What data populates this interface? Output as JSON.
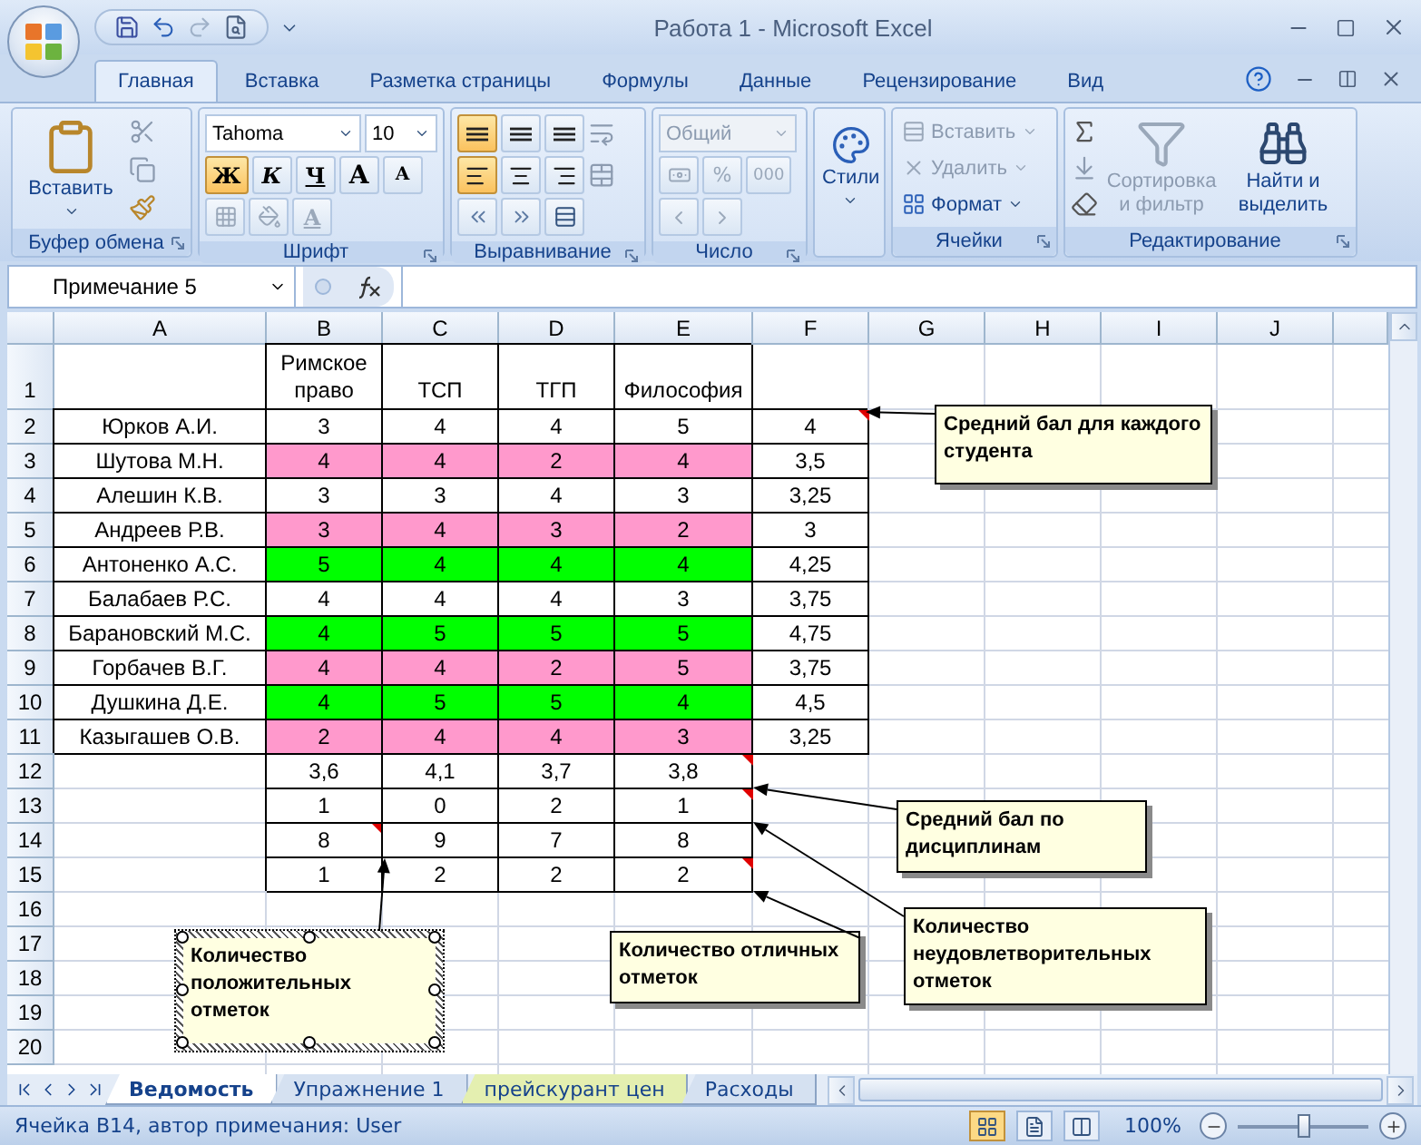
{
  "window": {
    "title": "Работа 1 - Microsoft Excel"
  },
  "ribbon": {
    "tabs": [
      {
        "label": "Главная",
        "selected": true
      },
      {
        "label": "Вставка",
        "selected": false
      },
      {
        "label": "Разметка страницы",
        "selected": false
      },
      {
        "label": "Формулы",
        "selected": false
      },
      {
        "label": "Данные",
        "selected": false
      },
      {
        "label": "Рецензирование",
        "selected": false
      },
      {
        "label": "Вид",
        "selected": false
      }
    ],
    "clipboard": {
      "label": "Буфер обмена",
      "paste": "Вставить"
    },
    "font": {
      "label": "Шрифт",
      "name": "Tahoma",
      "size": "10",
      "styles": [
        {
          "text": "Ж",
          "kind": "bold",
          "on": true
        },
        {
          "text": "К",
          "kind": "italic",
          "on": false
        },
        {
          "text": "Ч",
          "kind": "underline",
          "on": false
        }
      ],
      "grow": "A",
      "shrink": "A",
      "font_color": "A"
    },
    "alignment": {
      "label": "Выравнивание",
      "buttons": [
        {
          "kind": "top",
          "selected": true
        },
        {
          "kind": "middle",
          "selected": false
        },
        {
          "kind": "bottom",
          "selected": false
        },
        {
          "kind": "left",
          "selected": true
        },
        {
          "kind": "center",
          "selected": false
        },
        {
          "kind": "right",
          "selected": false
        }
      ]
    },
    "number": {
      "label": "Число",
      "format": "Общий",
      "format_disabled": true,
      "percent": "%",
      "thousands": "000"
    },
    "styles": {
      "button": "Стили"
    },
    "cells": {
      "label": "Ячейки",
      "buttons": [
        {
          "label": "Вставить",
          "kind": "insert",
          "disabled": true
        },
        {
          "label": "Удалить",
          "kind": "delete",
          "disabled": true
        },
        {
          "label": "Формат",
          "kind": "format",
          "disabled": false
        }
      ]
    },
    "editing": {
      "label": "Редактирование",
      "buttons": [
        {
          "label": "Сортировка и фильтр",
          "kind": "sort",
          "disabled": true
        },
        {
          "label": "Найти и выделить",
          "kind": "find",
          "disabled": false
        }
      ]
    }
  },
  "formula_bar": {
    "name_box": "Примечание 5"
  },
  "sheet": {
    "columns": [
      "A",
      "B",
      "C",
      "D",
      "E",
      "F",
      "G",
      "H",
      "I",
      "J"
    ],
    "rows": [
      {
        "number": "1",
        "cells": {
          "B": "Римское право",
          "C": "ТСП",
          "D": "ТГП",
          "E": "Философия"
        }
      },
      {
        "number": "2",
        "cells": {
          "A": "Юрков А.И.",
          "B": "3",
          "C": "4",
          "D": "4",
          "E": "5",
          "F": "4"
        },
        "notes": {
          "F": true
        }
      },
      {
        "number": "3",
        "cells": {
          "A": "Шутова М.Н.",
          "B": "4",
          "C": "4",
          "D": "2",
          "E": "4",
          "F": "3,5"
        },
        "color": "#ff99cc"
      },
      {
        "number": "4",
        "cells": {
          "A": "Алешин К.В.",
          "B": "3",
          "C": "3",
          "D": "4",
          "E": "3",
          "F": "3,25"
        }
      },
      {
        "number": "5",
        "cells": {
          "A": "Андреев Р.В.",
          "B": "3",
          "C": "4",
          "D": "3",
          "E": "2",
          "F": "3"
        },
        "color": "#ff99cc"
      },
      {
        "number": "6",
        "cells": {
          "A": "Антоненко А.С.",
          "B": "5",
          "C": "4",
          "D": "4",
          "E": "4",
          "F": "4,25"
        },
        "color": "#00ff00"
      },
      {
        "number": "7",
        "cells": {
          "A": "Балабаев Р.С.",
          "B": "4",
          "C": "4",
          "D": "4",
          "E": "3",
          "F": "3,75"
        }
      },
      {
        "number": "8",
        "cells": {
          "A": "Барановский М.С.",
          "B": "4",
          "C": "5",
          "D": "5",
          "E": "5",
          "F": "4,75"
        },
        "color": "#00ff00"
      },
      {
        "number": "9",
        "cells": {
          "A": "Горбачев В.Г.",
          "B": "4",
          "C": "4",
          "D": "2",
          "E": "5",
          "F": "3,75"
        },
        "color": "#ff99cc"
      },
      {
        "number": "10",
        "cells": {
          "A": "Душкина Д.Е.",
          "B": "4",
          "C": "5",
          "D": "5",
          "E": "4",
          "F": "4,5"
        },
        "color": "#00ff00"
      },
      {
        "number": "11",
        "cells": {
          "A": "Казыгашев О.В.",
          "B": "2",
          "C": "4",
          "D": "4",
          "E": "3",
          "F": "3,25"
        },
        "color": "#ff99cc"
      },
      {
        "number": "12",
        "cells": {
          "B": "3,6",
          "C": "4,1",
          "D": "3,7",
          "E": "3,8"
        },
        "notes": {
          "E": true
        }
      },
      {
        "number": "13",
        "cells": {
          "B": "1",
          "C": "0",
          "D": "2",
          "E": "1"
        },
        "notes": {
          "E": true
        }
      },
      {
        "number": "14",
        "cells": {
          "B": "8",
          "C": "9",
          "D": "7",
          "E": "8"
        },
        "notes": {
          "B": true
        }
      },
      {
        "number": "15",
        "cells": {
          "B": "1",
          "C": "2",
          "D": "2",
          "E": "2"
        },
        "notes": {
          "E": true
        }
      },
      {
        "number": "16",
        "cells": {}
      },
      {
        "number": "17",
        "cells": {}
      },
      {
        "number": "18",
        "cells": {}
      },
      {
        "number": "19",
        "cells": {}
      },
      {
        "number": "20",
        "cells": {}
      }
    ],
    "comments": [
      {
        "text": "Средний бал для каждого студента",
        "selected": false
      },
      {
        "text": "Средний бал по дисциплинам",
        "selected": false
      },
      {
        "text": "Количество положительных отметок",
        "selected": true
      },
      {
        "text": "Количество отличных отметок",
        "selected": false
      },
      {
        "text": "Количество неудовлетворительных отметок",
        "selected": false
      }
    ]
  },
  "sheet_tabs": [
    {
      "label": "Ведомость",
      "selected": true
    },
    {
      "label": "Упражнение 1",
      "selected": false
    },
    {
      "label": "прейскурант цен",
      "selected": false,
      "color": "#e4efb0"
    },
    {
      "label": "Расходы",
      "selected": false
    }
  ],
  "status_bar": {
    "text": "Ячейка B14, автор примечания: User",
    "views": [
      {
        "kind": "normal",
        "selected": true
      },
      {
        "kind": "layout",
        "selected": false
      },
      {
        "kind": "pagebreak",
        "selected": false
      }
    ],
    "zoom": "100%",
    "zoom_slider": {
      "level": 0.5
    }
  }
}
